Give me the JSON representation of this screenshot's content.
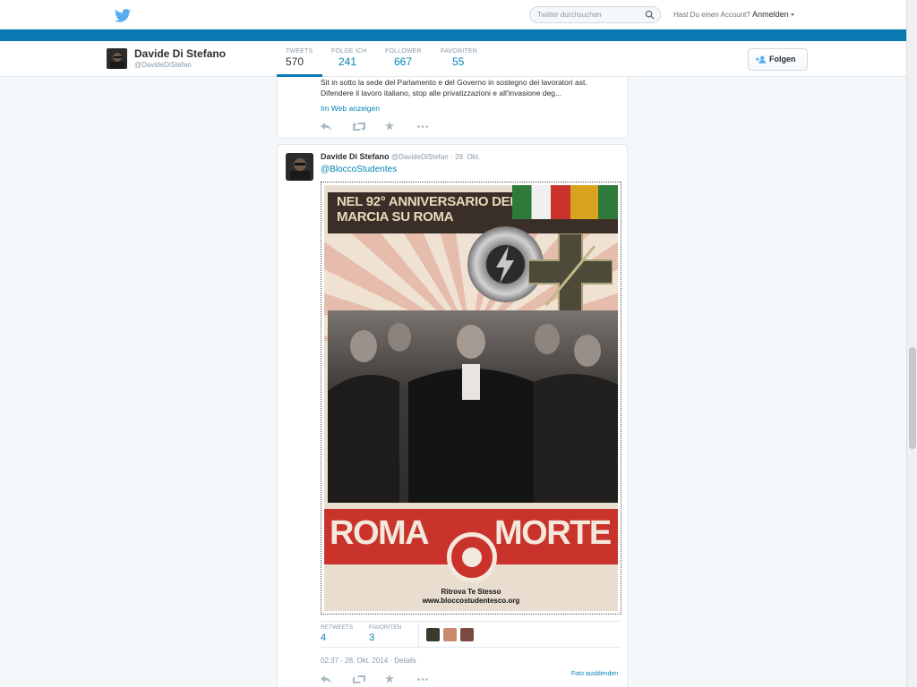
{
  "topbar": {
    "search_placeholder": "Twitter durchsuchen",
    "account_prompt": "Hast Du einen Account?",
    "login_label": "Anmelden"
  },
  "profile": {
    "name": "Davide Di Stefano",
    "handle": "@DavideDiStefan",
    "follow_label": "Folgen",
    "stats": [
      {
        "label": "TWEETS",
        "value": "570"
      },
      {
        "label": "FOLGE ICH",
        "value": "241"
      },
      {
        "label": "FOLLOWER",
        "value": "667"
      },
      {
        "label": "FAVORITEN",
        "value": "55"
      }
    ]
  },
  "tweet1": {
    "text_line1": "Sit in sotto la sede del Parlamento e del Governo in sostegno dei lavoratori ast.",
    "text_line2": "Difendere il lavoro italiano, stop alle privatizzazioni e all'invasione deg...",
    "web_link": "Im Web anzeigen"
  },
  "tweet2": {
    "name": "Davide Di Stefano",
    "handle": "@DavideDiStefan",
    "date": "· 28. Okt.",
    "mention": "@BloccoStudentes",
    "poster": {
      "title_line1": "NEL 92° ANNIVERSARIO DELLA",
      "title_line2": "MARCIA SU ROMA",
      "left_word": "ROMA",
      "right_word": "MORTE",
      "footer_line1": "Ritrova Te Stesso",
      "footer_line2": "www.bloccostudentesco.org"
    },
    "retweets_label": "RETWEETS",
    "retweets": "4",
    "favorites_label": "FAVORITEN",
    "favorites": "3",
    "timestamp": "02:37 - 28. Okt. 2014 · Details",
    "hide_photo": "Foto ausblenden"
  },
  "colors": {
    "brand_blue": "#0a7ab5",
    "link_blue": "#0084b4",
    "poster_red": "#c9332c"
  }
}
